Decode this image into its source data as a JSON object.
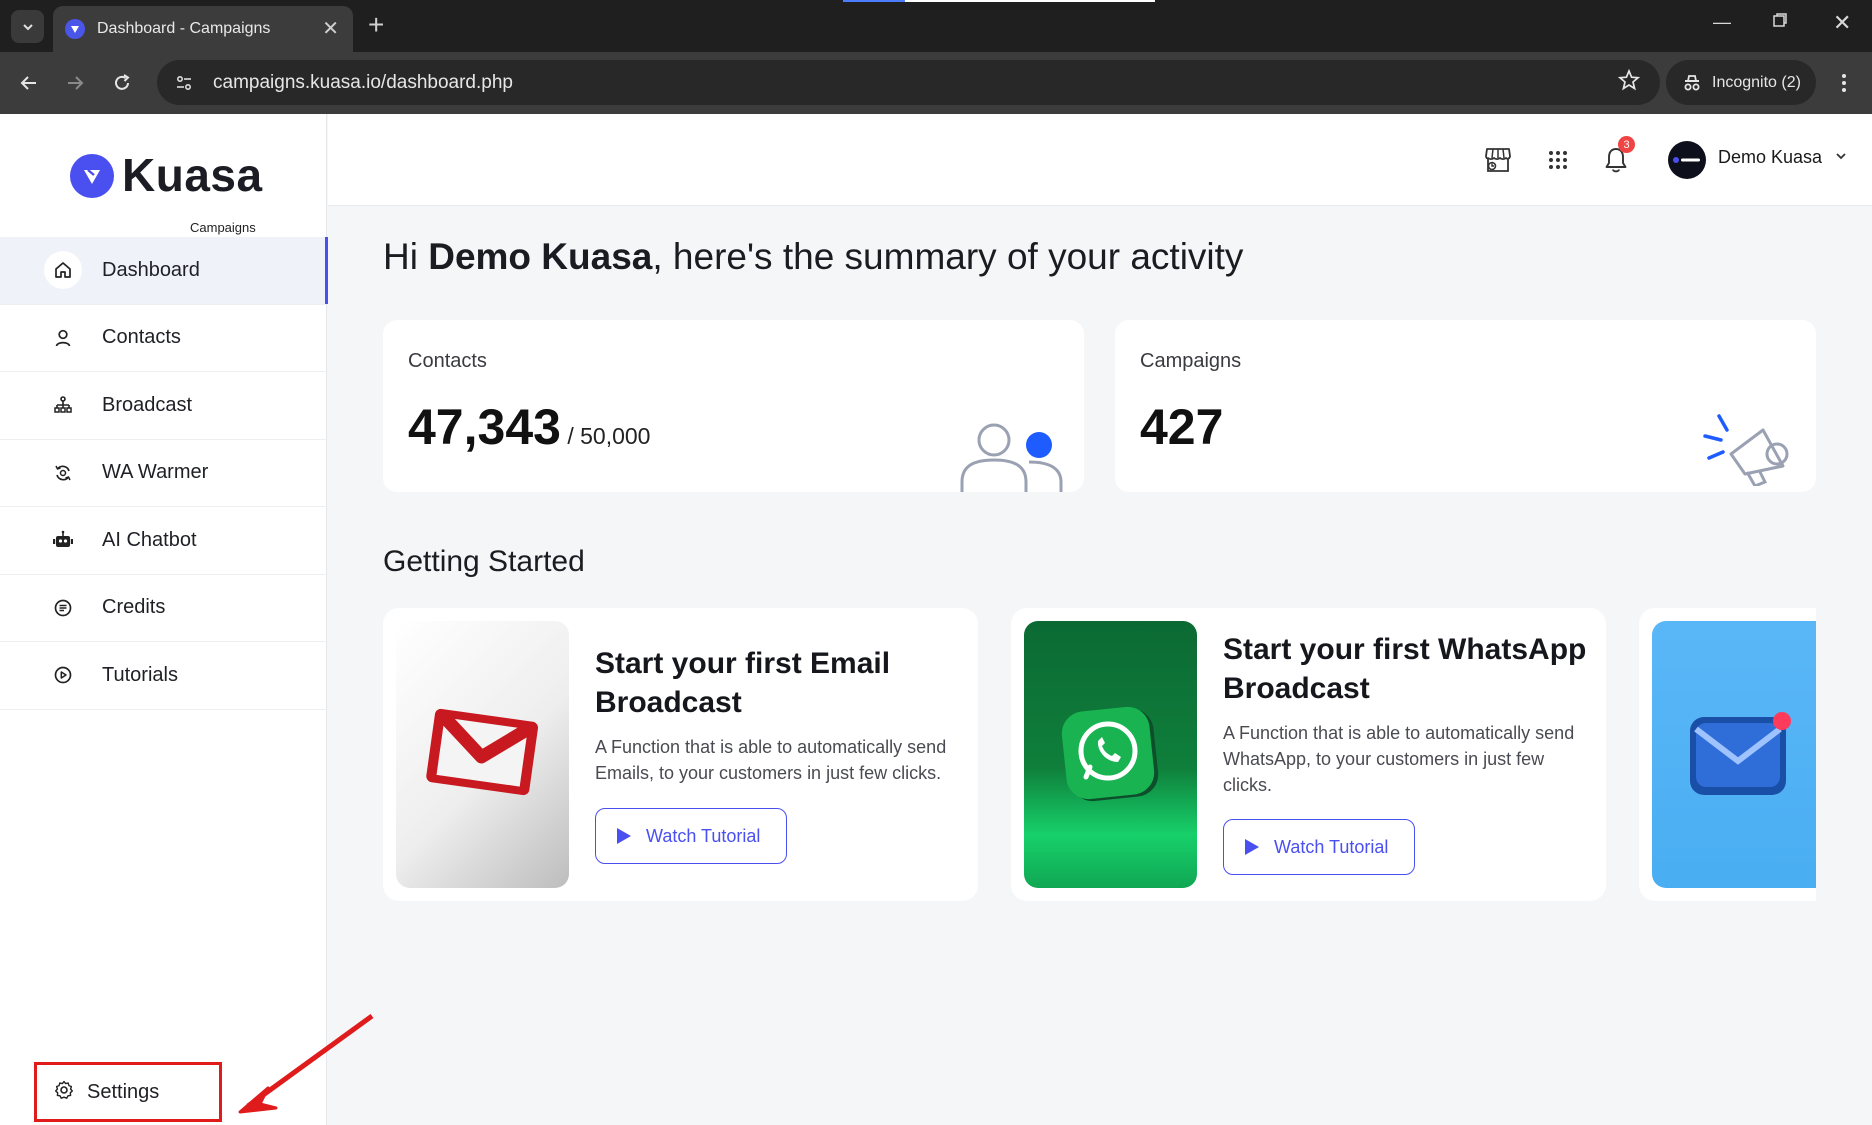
{
  "browser": {
    "tab_title": "Dashboard - Campaigns",
    "url": "campaigns.kuasa.io/dashboard.php",
    "incognito_label": "Incognito (2)"
  },
  "brand": {
    "name": "Kuasa",
    "subtitle": "Campaigns",
    "accent": "#4a4ff0"
  },
  "sidebar": {
    "items": [
      {
        "label": "Dashboard",
        "icon": "home-icon",
        "active": true
      },
      {
        "label": "Contacts",
        "icon": "user-icon"
      },
      {
        "label": "Broadcast",
        "icon": "broadcast-icon"
      },
      {
        "label": "WA Warmer",
        "icon": "warmer-icon"
      },
      {
        "label": "AI Chatbot",
        "icon": "robot-icon"
      },
      {
        "label": "Credits",
        "icon": "credits-icon"
      },
      {
        "label": "Tutorials",
        "icon": "play-circle-icon"
      }
    ],
    "settings_label": "Settings"
  },
  "header": {
    "notification_count": "3",
    "user_name": "Demo Kuasa"
  },
  "main": {
    "greeting_prefix": "Hi ",
    "greeting_name": "Demo Kuasa",
    "greeting_suffix": ", here's the summary of your activity",
    "stats": {
      "contacts_label": "Contacts",
      "contacts_value": "47,343",
      "contacts_total": " / 50,000",
      "campaigns_label": "Campaigns",
      "campaigns_value": "427"
    },
    "getting_started_title": "Getting Started",
    "cards": [
      {
        "title": "Start your first Email Broadcast",
        "description": "A Function that is able to automatically send Emails, to your customers in just few clicks.",
        "button": "Watch Tutorial"
      },
      {
        "title": "Start your first WhatsApp Broadcast",
        "description": "A Function that is able to automatically send WhatsApp, to your customers in just few clicks.",
        "button": "Watch Tutorial"
      }
    ]
  },
  "annotation_color": "#e01b1b"
}
